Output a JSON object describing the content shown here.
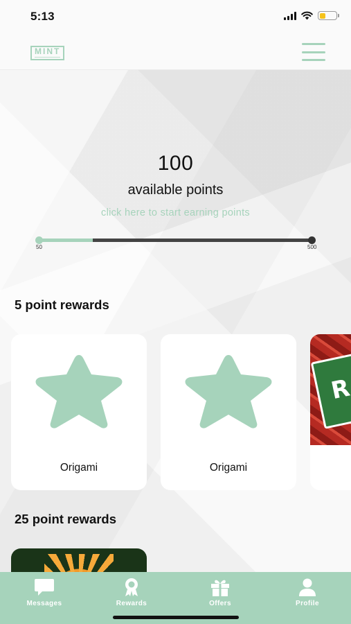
{
  "status_bar": {
    "time": "5:13"
  },
  "header": {
    "logo_text": "MINT"
  },
  "points": {
    "value": "100",
    "label": "available points",
    "earn_link": "click here to start earning points",
    "progress_min": "50",
    "progress_max": "500",
    "progress_fraction": 0.2
  },
  "sections": [
    {
      "title": "5 point rewards",
      "cards": [
        {
          "title": "Origami",
          "icon": "star-icon"
        },
        {
          "title": "Origami",
          "icon": "star-icon"
        },
        {
          "title": "",
          "icon": "reward-photo"
        }
      ]
    },
    {
      "title": "25 point rewards",
      "cards": [
        {
          "title": "",
          "icon": "flower-photo"
        }
      ]
    }
  ],
  "tab_bar": {
    "tabs": [
      {
        "label": "Messages",
        "icon": "message-icon"
      },
      {
        "label": "Rewards",
        "icon": "award-icon"
      },
      {
        "label": "Offers",
        "icon": "gift-icon"
      },
      {
        "label": "Profile",
        "icon": "person-icon"
      }
    ]
  },
  "colors": {
    "accent": "#a6d3bb",
    "progress_track": "#444444",
    "battery": "#f5c21b"
  }
}
